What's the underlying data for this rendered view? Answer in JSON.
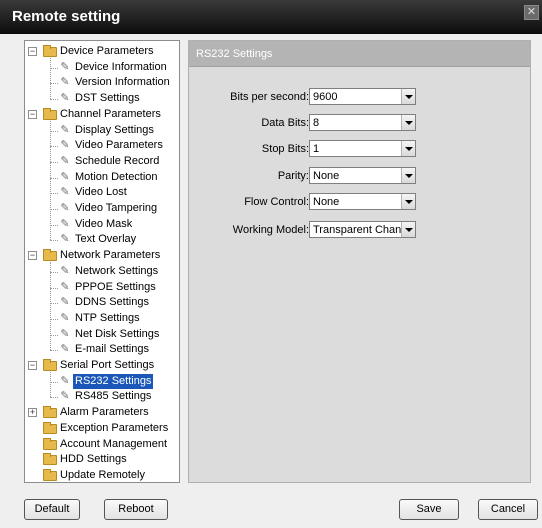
{
  "window": {
    "title": "Remote setting",
    "close_glyph": "✕"
  },
  "tree": [
    {
      "label": "Device Parameters",
      "type": "group",
      "expander": "−"
    },
    {
      "label": "Device Information",
      "type": "leaf"
    },
    {
      "label": "Version Information",
      "type": "leaf"
    },
    {
      "label": "DST Settings",
      "type": "leaf"
    },
    {
      "label": "Channel Parameters",
      "type": "group",
      "expander": "−"
    },
    {
      "label": "Display Settings",
      "type": "leaf"
    },
    {
      "label": "Video Parameters",
      "type": "leaf"
    },
    {
      "label": "Schedule Record",
      "type": "leaf"
    },
    {
      "label": "Motion Detection",
      "type": "leaf"
    },
    {
      "label": "Video Lost",
      "type": "leaf"
    },
    {
      "label": "Video Tampering",
      "type": "leaf"
    },
    {
      "label": "Video Mask",
      "type": "leaf"
    },
    {
      "label": "Text Overlay",
      "type": "leaf"
    },
    {
      "label": "Network Parameters",
      "type": "group",
      "expander": "−"
    },
    {
      "label": "Network Settings",
      "type": "leaf"
    },
    {
      "label": "PPPOE Settings",
      "type": "leaf"
    },
    {
      "label": "DDNS Settings",
      "type": "leaf"
    },
    {
      "label": "NTP Settings",
      "type": "leaf"
    },
    {
      "label": "Net Disk Settings",
      "type": "leaf"
    },
    {
      "label": "E-mail Settings",
      "type": "leaf"
    },
    {
      "label": "Serial Port Settings",
      "type": "group",
      "expander": "−"
    },
    {
      "label": "RS232 Settings",
      "type": "leaf",
      "selected": true
    },
    {
      "label": "RS485 Settings",
      "type": "leaf"
    },
    {
      "label": "Alarm Parameters",
      "type": "group",
      "expander": "+"
    },
    {
      "label": "Exception Parameters",
      "type": "group"
    },
    {
      "label": "Account Management",
      "type": "group"
    },
    {
      "label": "HDD Settings",
      "type": "group"
    },
    {
      "label": "Update Remotely",
      "type": "group"
    }
  ],
  "panel": {
    "title": "RS232 Settings",
    "fields": [
      {
        "label": "Bits per second:",
        "value": "9600"
      },
      {
        "label": "Data Bits:",
        "value": "8"
      },
      {
        "label": "Stop Bits:",
        "value": "1"
      },
      {
        "label": "Parity:",
        "value": "None"
      },
      {
        "label": "Flow Control:",
        "value": "None"
      },
      {
        "label": "Working Model:",
        "value": "Transparent Chanr"
      }
    ]
  },
  "buttons": {
    "default": "Default",
    "reboot": "Reboot",
    "save": "Save",
    "cancel": "Cancel"
  },
  "colors": {
    "selection": "#1a57b8",
    "folder": "#e7b84a",
    "header": "#b4b4b4"
  }
}
